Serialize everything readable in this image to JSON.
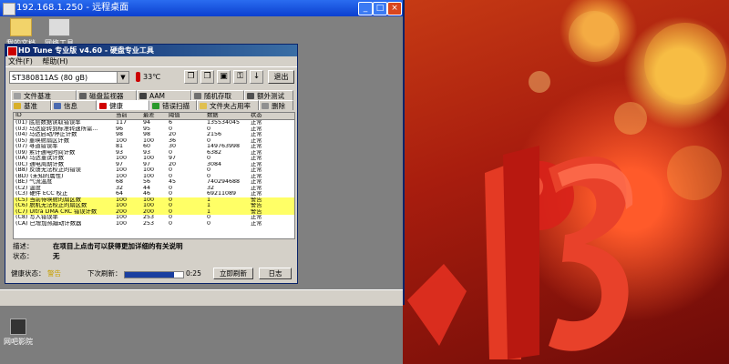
{
  "remote_window": {
    "title": "192.168.1.250 - 远程桌面",
    "min": "_",
    "max": "□",
    "close": "×"
  },
  "remote_desktop_icons": [
    {
      "label": "我的文档"
    },
    {
      "label": "网络工具"
    }
  ],
  "local_desktop_icon": {
    "label": "网吧影院"
  },
  "hdtune": {
    "title": "HD Tune 专业版 v4.60 - 硬盘专业工具",
    "menu": [
      "文件(F)",
      "帮助(H)"
    ],
    "drive": "ST380811AS (80 gB)",
    "temperature": "33℃",
    "exit_label": "退出",
    "tabs_row1": [
      {
        "label": "文件基准"
      },
      {
        "label": "磁盘监视器"
      },
      {
        "label": "AAM"
      },
      {
        "label": "随机存取"
      },
      {
        "label": "额外测试"
      }
    ],
    "tabs_row2": [
      {
        "label": "基准"
      },
      {
        "label": "信息"
      },
      {
        "label": "健康"
      },
      {
        "label": "错误扫描"
      },
      {
        "label": "文件夹占用率"
      },
      {
        "label": "删除"
      }
    ],
    "table": {
      "headers": [
        "ID",
        "当前",
        "最差",
        "阈值",
        "数据",
        "状态"
      ],
      "rows": [
        [
          "(01) 底层数据读取错误率",
          "117",
          "94",
          "6",
          "135534045",
          "正常"
        ],
        [
          "(03) 马达旋转到标准转速所需...",
          "96",
          "95",
          "0",
          "0",
          "正常"
        ],
        [
          "(04) 马达启动/停止计数",
          "98",
          "98",
          "20",
          "2156",
          "正常"
        ],
        [
          "(05) 重映射扇区计数",
          "100",
          "100",
          "36",
          "0",
          "正常"
        ],
        [
          "(07) 寻道错误率",
          "81",
          "60",
          "30",
          "149763998",
          "正常"
        ],
        [
          "(09) 累计通电时间计数",
          "93",
          "93",
          "0",
          "6382",
          "正常"
        ],
        [
          "(0A) 马达重试计数",
          "100",
          "100",
          "97",
          "0",
          "正常"
        ],
        [
          "(0C) 通电周期计数",
          "97",
          "97",
          "20",
          "3084",
          "正常"
        ],
        [
          "(B8) 反馈无法校正的错误",
          "100",
          "100",
          "0",
          "0",
          "正常"
        ],
        [
          "(BD) (未知的属性)",
          "100",
          "100",
          "0",
          "0",
          "正常"
        ],
        [
          "(BE) 气流温度",
          "68",
          "56",
          "45",
          "740294688",
          "正常"
        ],
        [
          "(C2) 温度",
          "32",
          "44",
          "0",
          "32",
          "正常"
        ],
        [
          "(C3) 硬件 ECC 校正",
          "64",
          "46",
          "0",
          "69211089",
          "正常"
        ],
        [
          "(C5) 当前待映射的扇区数",
          "100",
          "100",
          "0",
          "1",
          "警告"
        ],
        [
          "(C6) 脱机无法校正的扇区数",
          "100",
          "100",
          "0",
          "1",
          "警告"
        ],
        [
          "(C7) Ultra DMA CRC 错误计数",
          "200",
          "200",
          "0",
          "1",
          "警告"
        ],
        [
          "(C8) 写入错误率",
          "100",
          "253",
          "0",
          "0",
          "正常"
        ],
        [
          "(CA) 已增加热蹦动计数器",
          "100",
          "253",
          "0",
          "0",
          "正常"
        ]
      ],
      "warn_rows": [
        13,
        14,
        15
      ]
    },
    "description_label": "描述：",
    "description_value": "在项目上点击可以获得更加详细的有关说明",
    "state_label": "状态：",
    "state_value": "无",
    "health_label": "健康状态：",
    "health_value": "警告",
    "next_refresh_label": "下次刷新：",
    "refresh_progress": 0.85,
    "refresh_time": "0:25",
    "refresh_now_label": "立即刷新",
    "log_label": "日志"
  },
  "colors": {
    "warn_row": "#ffff66",
    "titlebar": "#0a246a",
    "accent_red": "#c00000"
  }
}
